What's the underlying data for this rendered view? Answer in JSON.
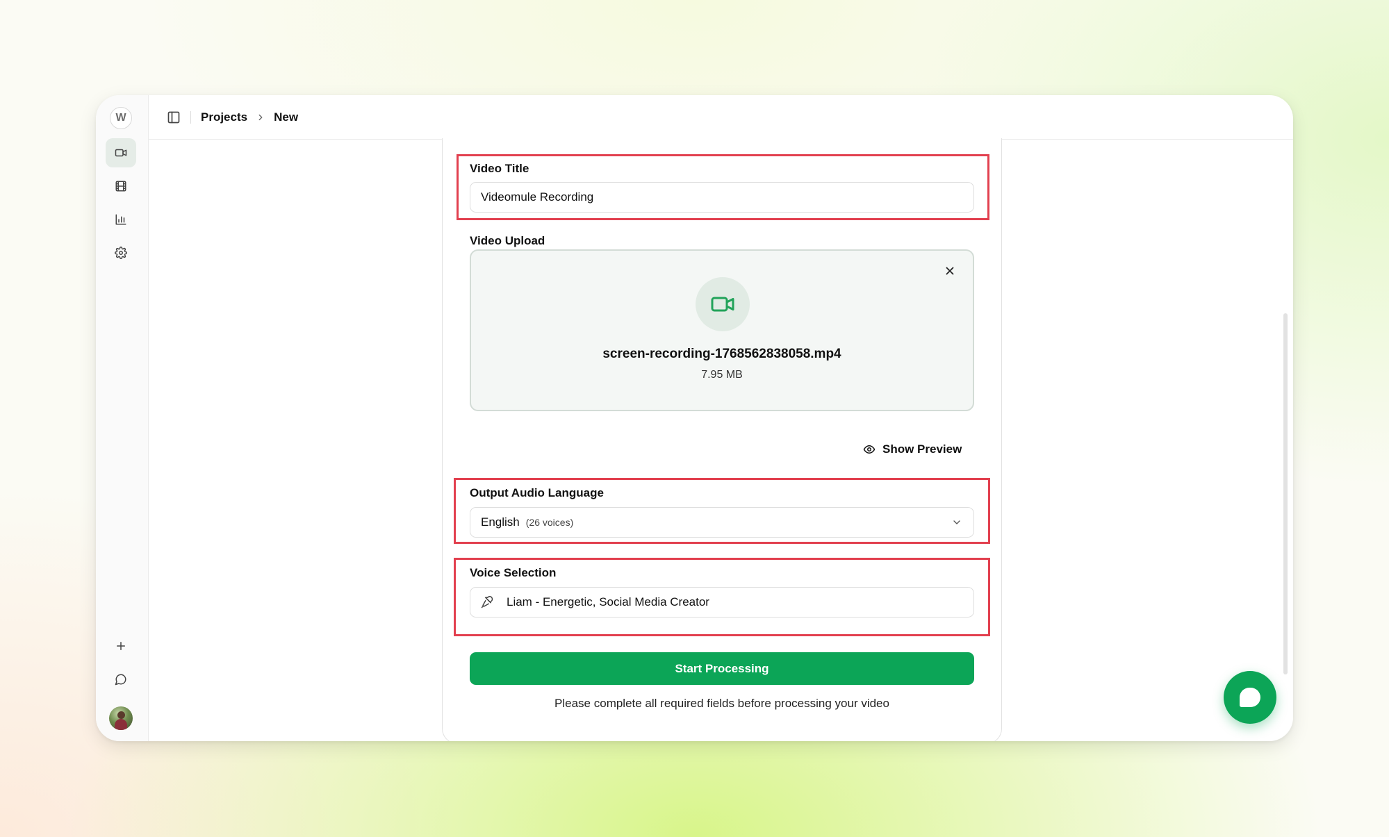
{
  "sidebar": {
    "logo": "W",
    "nav": [
      {
        "id": "videos",
        "icon": "video-camera-icon",
        "active": true
      },
      {
        "id": "library",
        "icon": "film-icon",
        "active": false
      },
      {
        "id": "analytics",
        "icon": "bar-chart-icon",
        "active": false
      },
      {
        "id": "settings",
        "icon": "gear-icon",
        "active": false
      }
    ],
    "bottom": [
      {
        "id": "new",
        "icon": "plus-icon"
      },
      {
        "id": "feedback",
        "icon": "chat-bubble-icon"
      },
      {
        "id": "profile",
        "icon": "avatar"
      }
    ]
  },
  "breadcrumb": {
    "items": [
      "Projects",
      "New"
    ]
  },
  "form": {
    "video_title": {
      "label": "Video Title",
      "value": "Videomule Recording"
    },
    "video_upload": {
      "label": "Video Upload",
      "file_name": "screen-recording-1768562838058.mp4",
      "file_size": "7.95 MB"
    },
    "show_preview": "Show Preview",
    "output_audio_language": {
      "label": "Output Audio Language",
      "selected": "English",
      "voice_count": "(26 voices)"
    },
    "voice_selection": {
      "label": "Voice Selection",
      "value": "Liam - Energetic, Social Media Creator"
    },
    "start_button": "Start Processing",
    "hint": "Please complete all required fields before processing your video"
  },
  "colors": {
    "accent": "#0ca557",
    "highlight": "#e2404f"
  }
}
